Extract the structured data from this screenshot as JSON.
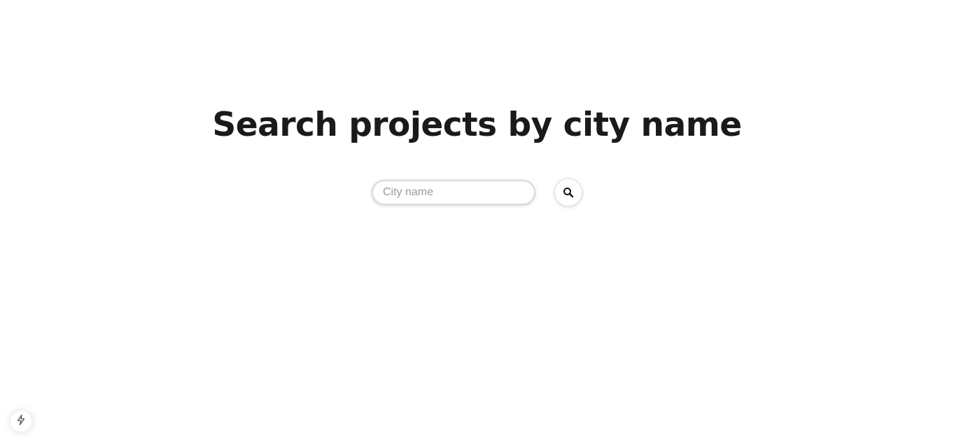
{
  "main": {
    "title": "Search projects by city name"
  },
  "search": {
    "placeholder": "City name",
    "value": "",
    "button_icon": "search-icon"
  },
  "dev_indicator": {
    "icon": "lightning-bolt-icon"
  }
}
